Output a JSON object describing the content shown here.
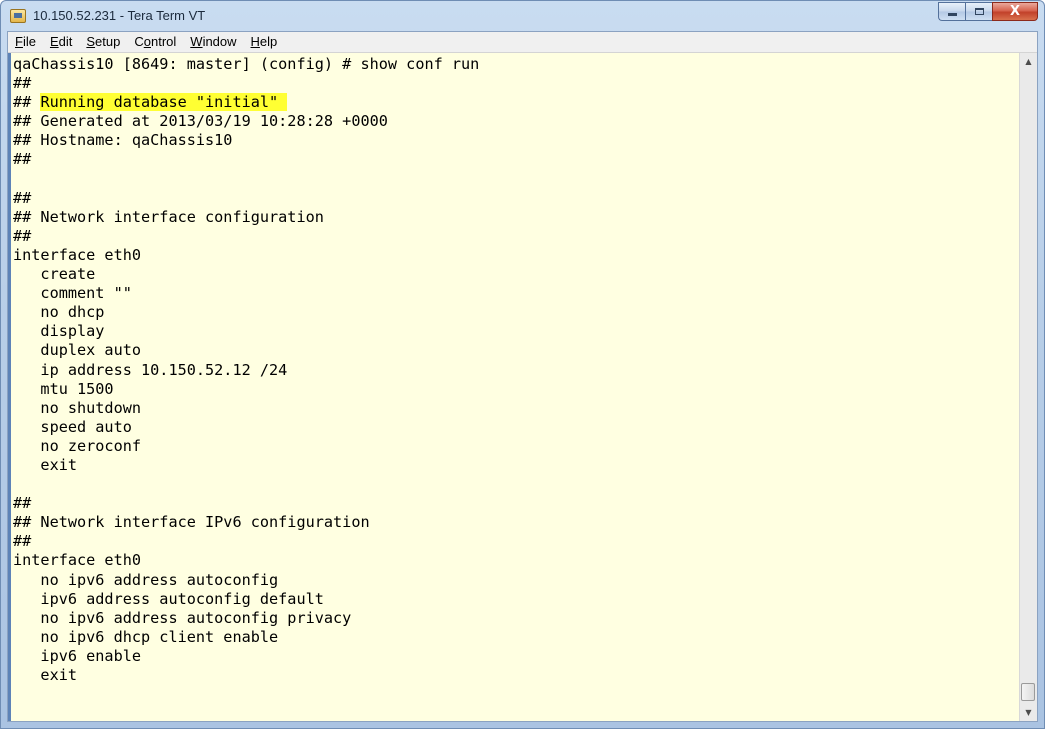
{
  "window": {
    "title": "10.150.52.231 - Tera Term VT",
    "app_icon": "tera-term-icon"
  },
  "caption_buttons": {
    "minimize_icon": "minimize-icon",
    "maximize_icon": "maximize-icon",
    "close_label": "X"
  },
  "menubar": {
    "items": [
      {
        "label": "File",
        "mnemonic": "F",
        "rest": "ile"
      },
      {
        "label": "Edit",
        "mnemonic": "E",
        "rest": "dit"
      },
      {
        "label": "Setup",
        "mnemonic": "S",
        "rest": "etup"
      },
      {
        "label": "Control",
        "mnemonic_pre": "C",
        "mnemonic": "o",
        "rest": "ntrol"
      },
      {
        "label": "Window",
        "mnemonic": "W",
        "rest": "indow"
      },
      {
        "label": "Help",
        "mnemonic": "H",
        "rest": "elp"
      }
    ]
  },
  "terminal": {
    "background": "#ffffe1",
    "highlight_color": "#ffff33",
    "lines": [
      "qaChassis10 [8649: master] (config) # show conf run",
      "##",
      "## Running database \"initial\"",
      "## Generated at 2013/03/19 10:28:28 +0000",
      "## Hostname: qaChassis10",
      "##",
      "",
      "##",
      "## Network interface configuration",
      "##",
      "interface eth0",
      "   create",
      "   comment \"\"",
      "   no dhcp",
      "   display",
      "   duplex auto",
      "   ip address 10.150.52.12 /24",
      "   mtu 1500",
      "   no shutdown",
      "   speed auto",
      "   no zeroconf",
      "   exit",
      "",
      "##",
      "## Network interface IPv6 configuration",
      "##",
      "interface eth0",
      "   no ipv6 address autoconfig",
      "   ipv6 address autoconfig default",
      "   no ipv6 address autoconfig privacy",
      "   no ipv6 dhcp client enable",
      "   ipv6 enable",
      "   exit"
    ],
    "highlighted_line_prefix": "## ",
    "highlighted_text": "Running database \"initial\" "
  },
  "scrollbar": {
    "up_icon": "scroll-up-arrow-icon",
    "down_icon": "scroll-down-arrow-icon",
    "position": "bottom"
  }
}
